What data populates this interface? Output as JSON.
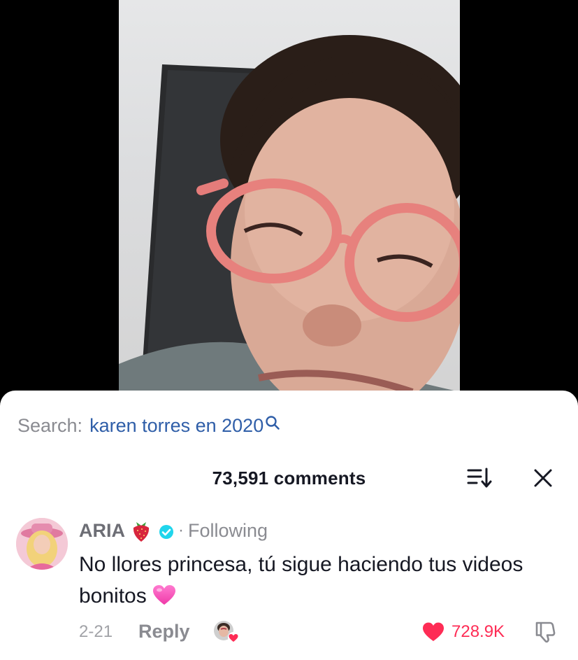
{
  "colors": {
    "accent_like": "#fe2c55",
    "search_term": "#2f5ea8",
    "verified": "#20d5ec",
    "muted_text": "#8a8b91"
  },
  "video": {
    "description_icon": "video-thumbnail"
  },
  "search": {
    "prefix": "Search:",
    "term": "karen torres en 2020",
    "icon": "search-icon"
  },
  "comments_header": {
    "count_label": "73,591 comments",
    "sort_icon": "sort-icon",
    "close_icon": "close-icon"
  },
  "comment": {
    "username": "ARIA",
    "badge_icons": [
      "strawberry-icon",
      "verified-icon"
    ],
    "separator": "·",
    "following_label": "Following",
    "text": "No llores princesa, tú sigue haciendo tus videos bonitos",
    "emoji_icon": "pink-heart-emoji",
    "date": "2-21",
    "reply_label": "Reply",
    "like_count": "728.9K",
    "liked": true
  }
}
